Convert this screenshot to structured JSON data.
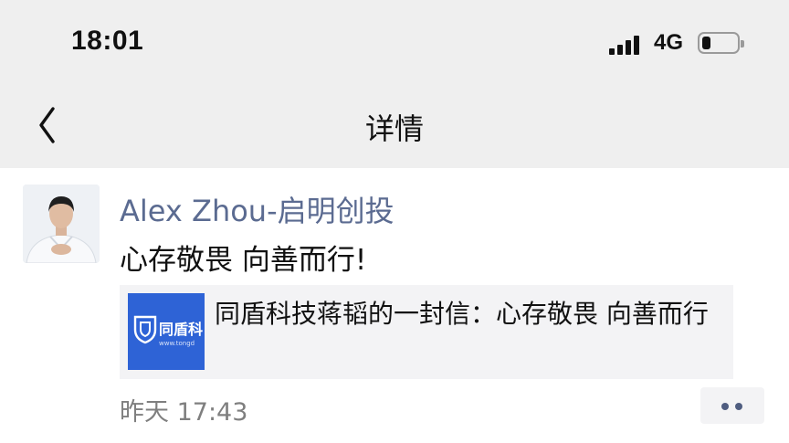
{
  "status_bar": {
    "time": "18:01",
    "network": "4G",
    "battery_level": 0.25,
    "icons": [
      "signal-icon",
      "battery-icon"
    ]
  },
  "nav": {
    "title": "详情",
    "back_icon": "chevron-left-icon"
  },
  "post": {
    "author": "Alex Zhou-启明创投",
    "text": "心存敬畏 向善而行!",
    "link_card": {
      "title": "同盾科技蒋韬的一封信：心存敬畏 向善而行",
      "thumbnail_text": "同盾科",
      "thumbnail_url_text": "www.tongd",
      "thumbnail_color": "#2e63d6"
    },
    "timestamp": "昨天 17:43",
    "more_icon": "more-dots-icon"
  },
  "colors": {
    "bar_background": "#efefef",
    "author_name": "#5b6b91",
    "card_background": "#f3f3f5"
  }
}
